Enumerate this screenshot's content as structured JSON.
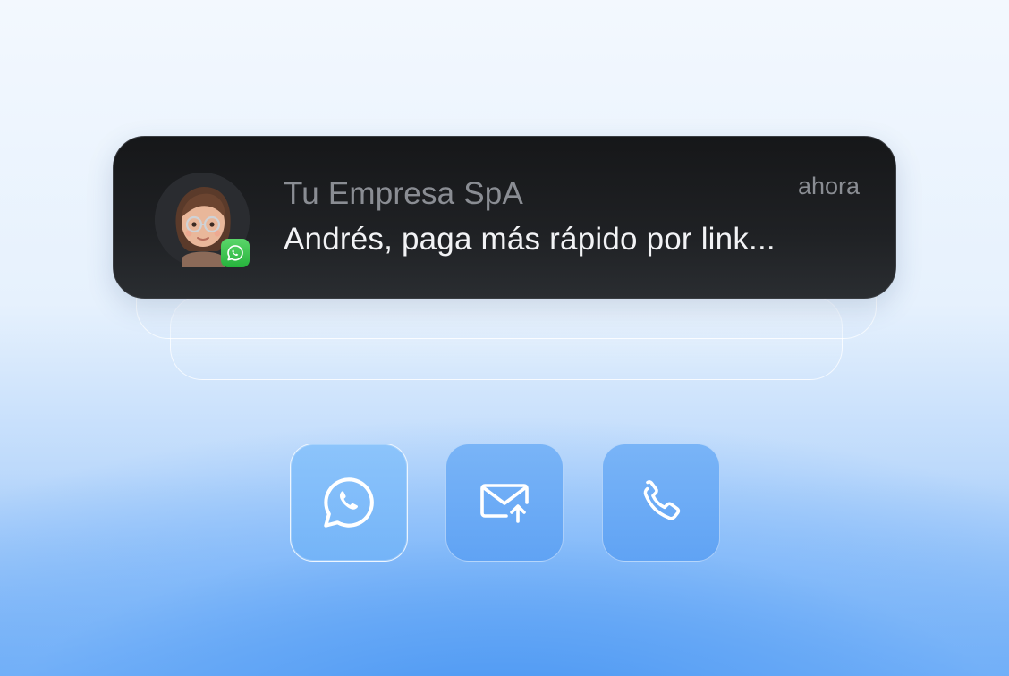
{
  "notification": {
    "sender": "Tu Empresa SpA",
    "time": "ahora",
    "message": "Andrés, paga más rápido por link..."
  },
  "actions": [
    {
      "icon": "whatsapp-icon"
    },
    {
      "icon": "email-send-icon"
    },
    {
      "icon": "phone-icon"
    }
  ],
  "colors": {
    "card_bg": "#1f2124",
    "sender_text": "#8a8d93",
    "message_text": "#f2f3f5",
    "whatsapp_green": "#26b33c",
    "button_blue": "#6aaaf6"
  }
}
